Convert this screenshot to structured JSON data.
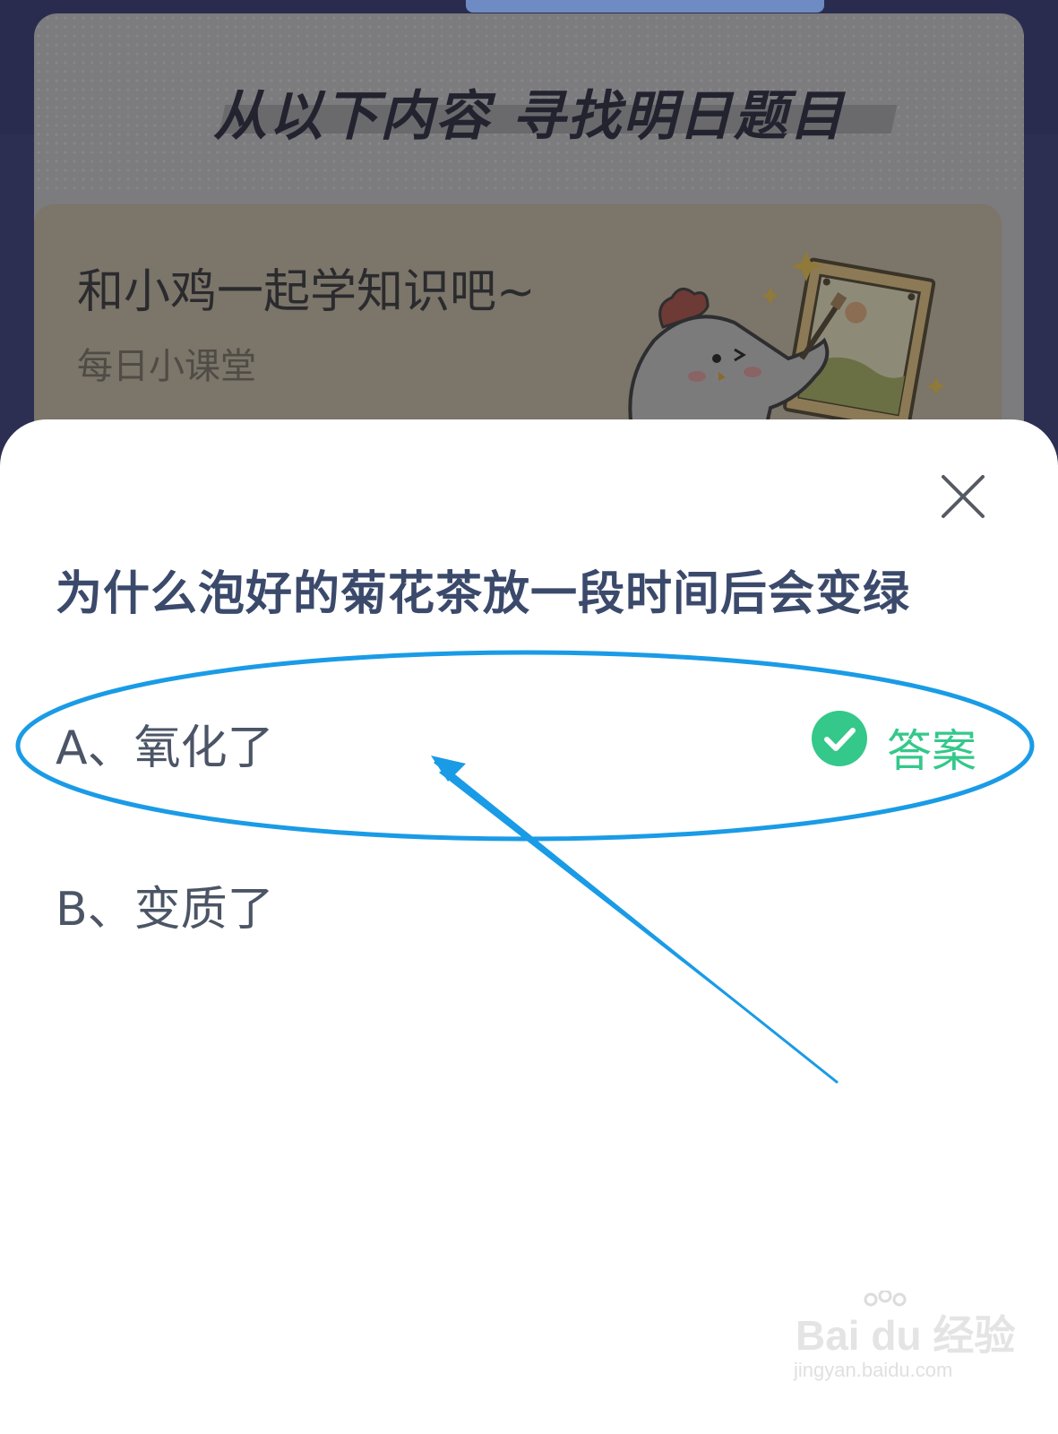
{
  "background": {
    "heading": "从以下内容  寻找明日题目",
    "lesson_card": {
      "title": "和小鸡一起学知识吧~",
      "subtitle": "每日小课堂"
    }
  },
  "modal": {
    "question": "为什么泡好的菊花茶放一段时间后会变绿",
    "options": [
      {
        "label": "A、氧化了",
        "is_answer": true,
        "answer_tag": "答案"
      },
      {
        "label": "B、变质了",
        "is_answer": false
      }
    ],
    "close_icon": "close-icon"
  },
  "annotation": {
    "color": "#1a9be6",
    "shapes": [
      "ellipse-around-option-a",
      "arrow-pointing-to-option-a"
    ]
  },
  "watermark": {
    "logo": "Bai du 经验",
    "url": "jingyan.baidu.com"
  },
  "colors": {
    "question_text": "#3b4a6b",
    "answer_green": "#34c88a",
    "annotation_blue": "#1a9be6"
  }
}
